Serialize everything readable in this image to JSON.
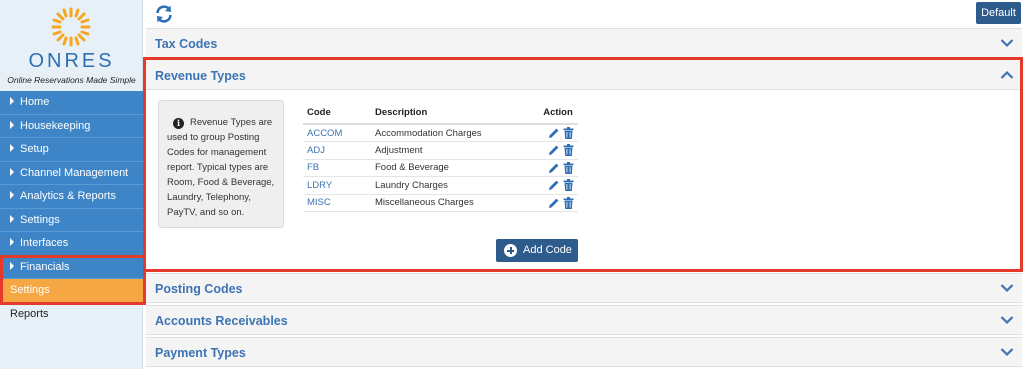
{
  "brand": {
    "name": "ONRES",
    "tagline": "Online Reservations Made Simple"
  },
  "nav": {
    "items": [
      {
        "label": "Home"
      },
      {
        "label": "Housekeeping"
      },
      {
        "label": "Setup"
      },
      {
        "label": "Channel Management"
      },
      {
        "label": "Analytics & Reports"
      },
      {
        "label": "Settings"
      },
      {
        "label": "Interfaces"
      },
      {
        "label": "Financials"
      }
    ],
    "sub_active": "Settings",
    "sub_plain": "Reports"
  },
  "topbar": {
    "default_label": "Default"
  },
  "panels": {
    "tax_codes": "Tax Codes",
    "revenue_types": "Revenue Types",
    "posting_codes": "Posting Codes",
    "accounts_receivables": "Accounts Receivables",
    "payment_types": "Payment Types"
  },
  "revenue": {
    "info_text": "Revenue Types are used to group Posting Codes for management report. Typical types are Room, Food & Beverage, Laundry, Telephony, PayTV, and so on.",
    "columns": [
      "Code",
      "Description",
      "Action"
    ],
    "rows": [
      {
        "code": "ACCOM",
        "description": "Accommodation Charges"
      },
      {
        "code": "ADJ",
        "description": "Adjustment"
      },
      {
        "code": "FB",
        "description": "Food & Beverage"
      },
      {
        "code": "LDRY",
        "description": "Laundry Charges"
      },
      {
        "code": "MISC",
        "description": "Miscellaneous Charges"
      }
    ],
    "add_label": "Add Code"
  },
  "colors": {
    "nav_blue": "#3d85c6",
    "nav_active": "#f4a742",
    "highlight": "#e5392a",
    "button": "#2d5b8b",
    "link": "#3c73b3"
  },
  "icons": [
    "refresh-icon",
    "chevron-down-icon",
    "chevron-up-icon",
    "info-icon",
    "edit-icon",
    "trash-icon",
    "plus-circle-icon"
  ]
}
